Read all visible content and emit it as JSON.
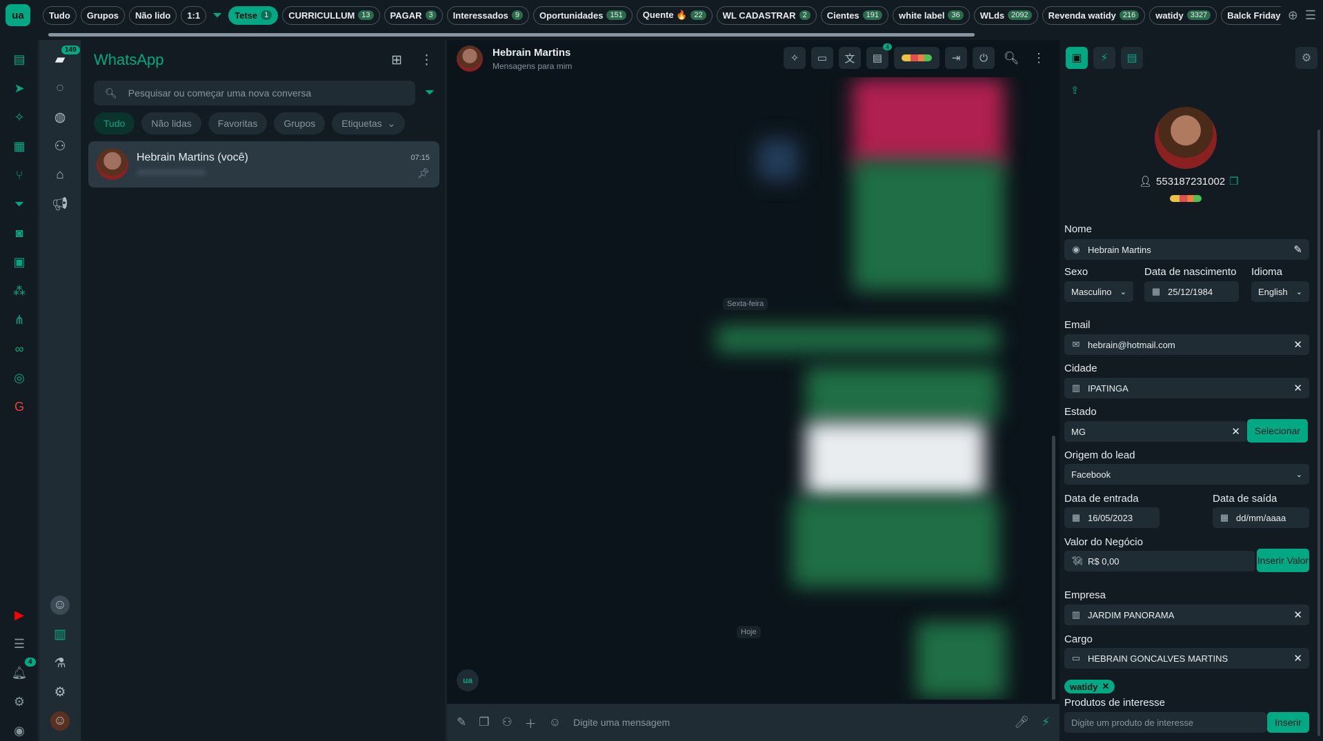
{
  "topbar": {
    "logo": "ua",
    "tabs": [
      {
        "label": "Tudo",
        "count": null,
        "active": false
      },
      {
        "label": "Grupos",
        "count": null,
        "active": false
      },
      {
        "label": "Não lido",
        "count": null,
        "active": false
      },
      {
        "label": "1:1",
        "count": null,
        "active": false
      },
      {
        "label": "Tetse",
        "count": "1",
        "active": true
      },
      {
        "label": "CURRICULLUM",
        "count": "13",
        "active": false
      },
      {
        "label": "PAGAR",
        "count": "3",
        "active": false
      },
      {
        "label": "Interessados",
        "count": "9",
        "active": false
      },
      {
        "label": "Oportunidades",
        "count": "151",
        "active": false
      },
      {
        "label": "Quente 🔥",
        "count": "22",
        "active": false
      },
      {
        "label": "WL CADASTRAR",
        "count": "2",
        "active": false
      },
      {
        "label": "Cientes",
        "count": "191",
        "active": false
      },
      {
        "label": "white label",
        "count": "36",
        "active": false
      },
      {
        "label": "WLds",
        "count": "2092",
        "active": false
      },
      {
        "label": "Revenda watidy",
        "count": "216",
        "active": false
      },
      {
        "label": "watidy",
        "count": "3327",
        "active": false
      },
      {
        "label": "Balck Friday revenda",
        "count": null,
        "active": false
      }
    ]
  },
  "rail2": {
    "inbox_badge": "149",
    "bell_badge": "4"
  },
  "chatlist": {
    "title": "WhatsApp",
    "search_placeholder": "Pesquisar ou começar uma nova conversa",
    "chips": [
      {
        "label": "Tudo",
        "active": true
      },
      {
        "label": "Não lidas",
        "active": false
      },
      {
        "label": "Favoritas",
        "active": false
      },
      {
        "label": "Grupos",
        "active": false
      },
      {
        "label": "Etiquetas",
        "active": false
      }
    ],
    "chats": [
      {
        "name": "Hebrain Martins (você)",
        "time": "07:15"
      }
    ]
  },
  "conversation": {
    "name": "Hebrain Martins",
    "subtitle": "Mensagens para mim",
    "action_badge": "4",
    "day_labels": [
      "Sexta-feira",
      "Hoje"
    ],
    "float_logo": "ua",
    "composer_placeholder": "Digite uma mensagem"
  },
  "contact": {
    "phone": "553187231002",
    "nome_label": "Nome",
    "nome": "Hebrain Martins",
    "sexo_label": "Sexo",
    "sexo": "Masculino",
    "nascimento_label": "Data de nascimento",
    "nascimento": "25/12/1984",
    "idioma_label": "Idioma",
    "idioma": "English",
    "email_label": "Email",
    "email": "hebrain@hotmail.com",
    "cidade_label": "Cidade",
    "cidade": "IPATINGA",
    "estado_label": "Estado",
    "estado": "MG",
    "selecionar": "Selecionar",
    "origem_label": "Origem do lead",
    "origem": "Facebook",
    "entrada_label": "Data de entrada",
    "entrada": "16/05/2023",
    "saida_label": "Data de saída",
    "saida_placeholder": "dd/mm/aaaa",
    "valor_label": "Valor do Negócio",
    "valor": "R$ 0,00",
    "inserir_valor": "Inserir Valor",
    "empresa_label": "Empresa",
    "empresa": "JARDIM PANORAMA",
    "cargo_label": "Cargo",
    "cargo": "HEBRAIN GONCALVES MARTINS",
    "tag": "watidy",
    "produtos_label": "Produtos de interesse",
    "produtos_placeholder": "Digite um produto de interesse",
    "inserir": "Inserir"
  }
}
